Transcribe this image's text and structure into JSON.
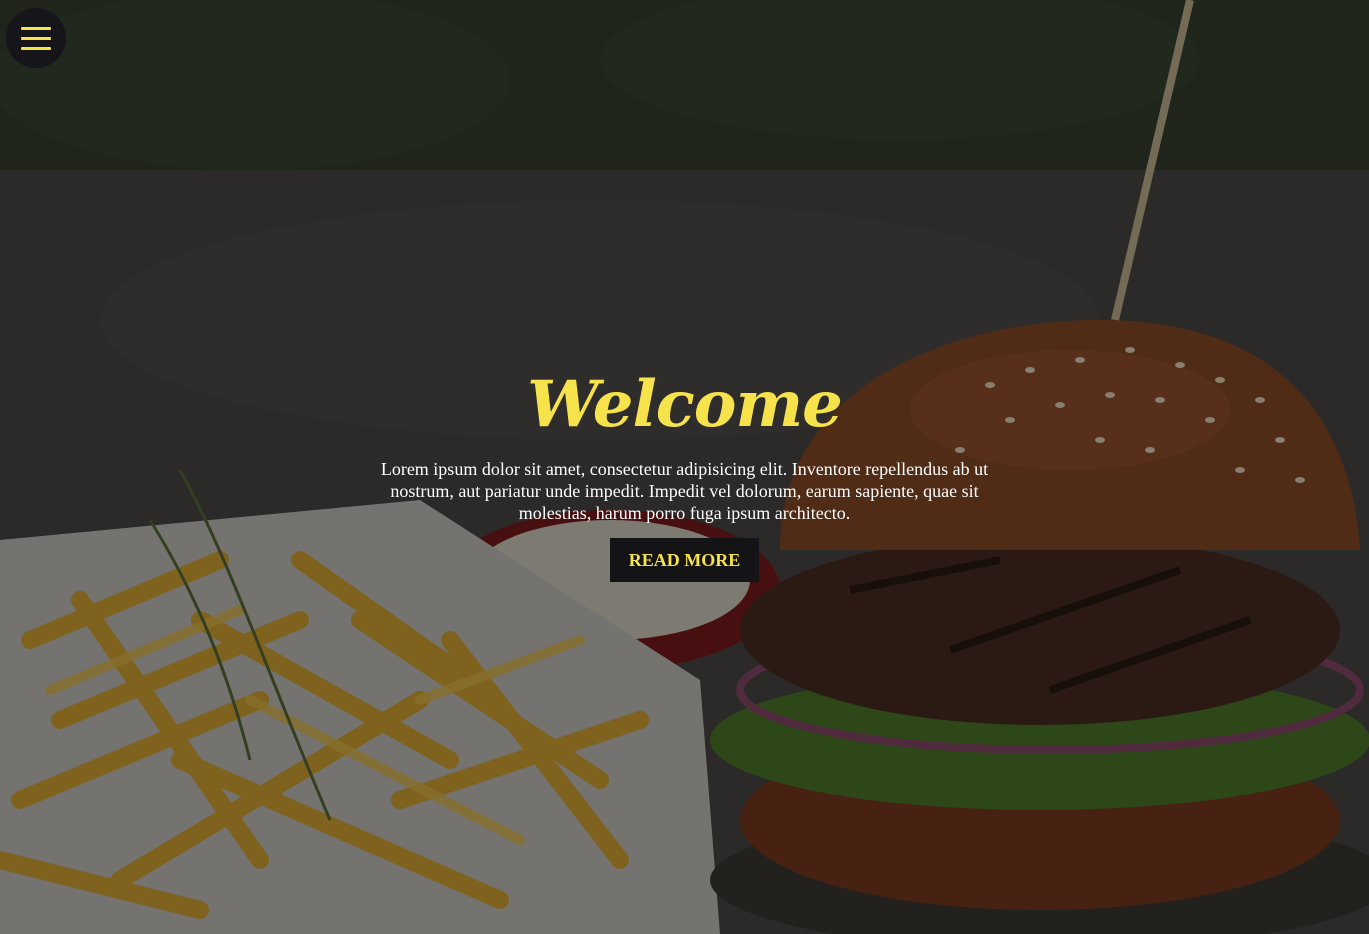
{
  "nav": {
    "menu_icon": "hamburger-menu-icon"
  },
  "hero": {
    "title": "Welcome",
    "body": "Lorem ipsum dolor sit amet, consectetur adipisicing elit. Inventore repellendus ab ut nostrum, aut pariatur unde impedit. Impedit vel dolorum, earum sapiente, quae sit molestias, harum porro fuga ipsum architecto.",
    "button_label": "READ MORE"
  },
  "colors": {
    "accent": "#f6e24a",
    "button_bg": "#141416",
    "text": "#ffffff"
  }
}
